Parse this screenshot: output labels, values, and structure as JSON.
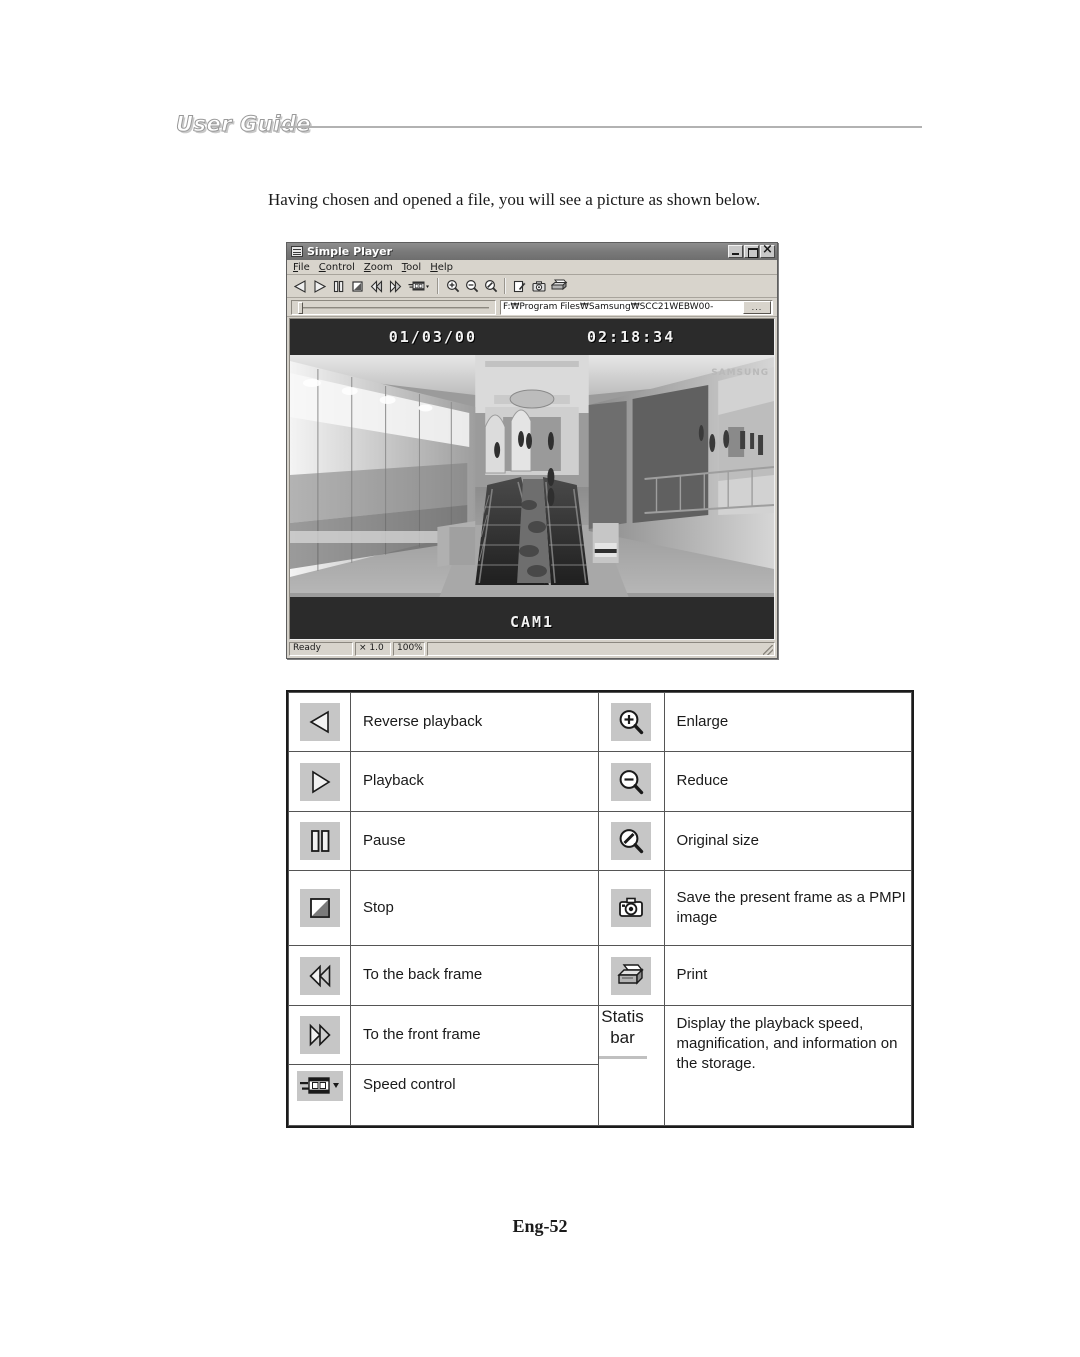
{
  "page": {
    "header_title": "User Guide",
    "intro_text": "Having chosen and opened a file, you will see a picture as shown below.",
    "footer": "Eng-52"
  },
  "app_window": {
    "title": "Simple Player",
    "title_icon": "player-window-icon",
    "window_buttons": {
      "minimize": "minimize-icon",
      "maximize": "maximize-icon",
      "close": "close-icon"
    },
    "menu": [
      {
        "label": "File",
        "accel": "F"
      },
      {
        "label": "Control",
        "accel": "C"
      },
      {
        "label": "Zoom",
        "accel": "Z"
      },
      {
        "label": "Tool",
        "accel": "T"
      },
      {
        "label": "Help",
        "accel": "H"
      }
    ],
    "toolbar": [
      {
        "name": "reverse-playback-icon",
        "tip": "Reverse playback"
      },
      {
        "name": "playback-icon",
        "tip": "Playback"
      },
      {
        "name": "pause-icon",
        "tip": "Pause"
      },
      {
        "name": "stop-icon",
        "tip": "Stop"
      },
      {
        "name": "back-frame-icon",
        "tip": "To the back frame"
      },
      {
        "name": "front-frame-icon",
        "tip": "To the front frame"
      },
      {
        "name": "speed-control-icon",
        "tip": "Speed control"
      },
      {
        "name": "zoom-in-icon",
        "tip": "Enlarge"
      },
      {
        "name": "zoom-out-icon",
        "tip": "Reduce"
      },
      {
        "name": "zoom-original-icon",
        "tip": "Original size"
      },
      {
        "name": "edit-icon",
        "tip": "Edit"
      },
      {
        "name": "camera-icon",
        "tip": "Save the present frame as a PMPI image"
      },
      {
        "name": "print-icon",
        "tip": "Print"
      }
    ],
    "path_field": {
      "value": "F:₩Program Files₩Samsung₩SCC21WEBW00-",
      "browse_label": "..."
    },
    "video": {
      "date": "01/03/00",
      "time": "02:18:34",
      "camera": "CAM1"
    },
    "statusbar": {
      "state": "Ready",
      "speed": "× 1.0",
      "zoom": "100%"
    }
  },
  "legend": {
    "rows": [
      {
        "left_icon": "reverse-playback-icon",
        "left_label": "Reverse playback",
        "right_icon": "zoom-in-icon",
        "right_label": "Enlarge"
      },
      {
        "left_icon": "playback-icon",
        "left_label": "Playback",
        "right_icon": "zoom-out-icon",
        "right_label": "Reduce"
      },
      {
        "left_icon": "pause-icon",
        "left_label": "Pause",
        "right_icon": "zoom-original-icon",
        "right_label": "Original size"
      },
      {
        "left_icon": "stop-icon",
        "left_label": "Stop",
        "right_icon": "camera-icon",
        "right_label": "Save the present frame as a PMPI image"
      },
      {
        "left_icon": "back-frame-icon",
        "left_label": "To the back frame",
        "right_icon": "print-icon",
        "right_label": "Print"
      },
      {
        "left_icon": "front-frame-icon",
        "left_label": "To the front  frame",
        "right_icon": "status-bar-text",
        "right_label": "Display the playback speed, magnification, and information on the storage.",
        "right_icon_text": "Statis bar"
      },
      {
        "left_icon": "speed-control-icon",
        "left_label": "Speed control",
        "right_icon": "",
        "right_label": ""
      }
    ]
  },
  "colors": {
    "window_face": "#d4d0c8",
    "titlebar": "#7a7a7a",
    "video_bg": "#2b2b2b",
    "icon_tile": "#c6c6c6",
    "table_border": "#1a1a1a"
  }
}
